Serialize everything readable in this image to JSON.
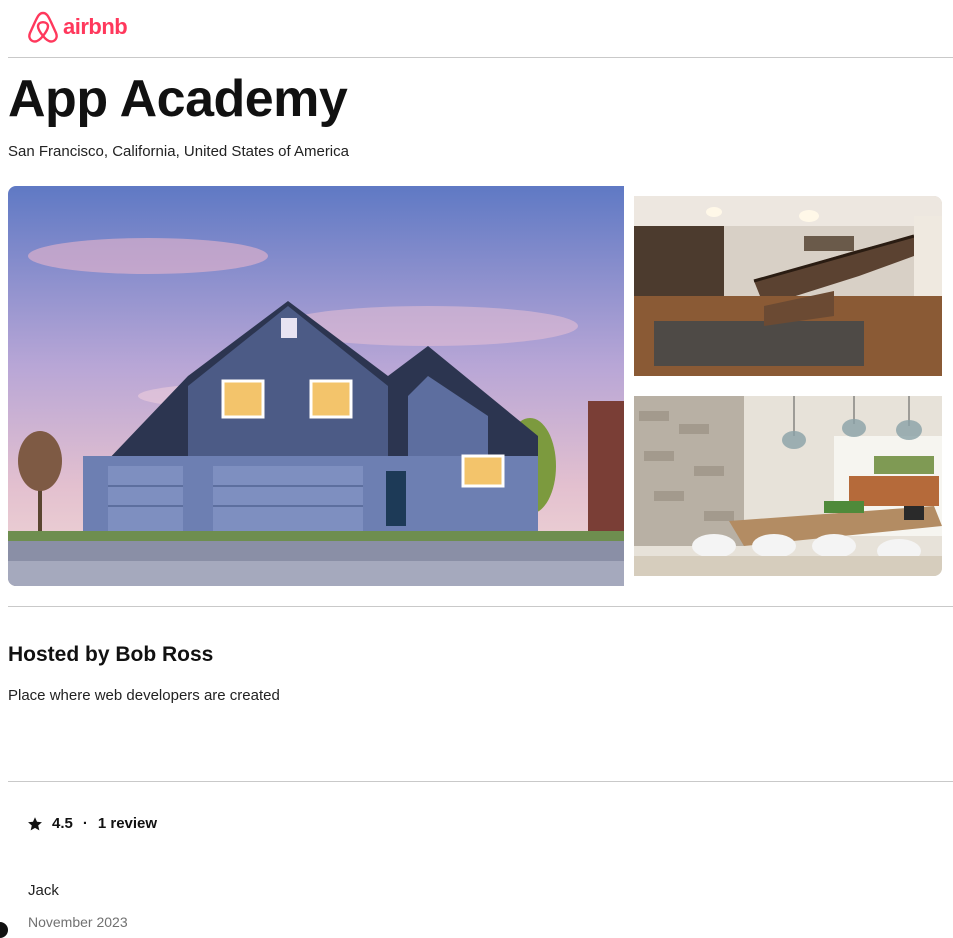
{
  "header": {
    "brand": "airbnb",
    "brand_color": "#ff385c",
    "logo_icon": "airbnb-belo-icon"
  },
  "listing": {
    "title": "App Academy",
    "location": "San Francisco, California, United States of America",
    "photos": {
      "main": "house-exterior-image",
      "top": "staircase-interior-image",
      "bottom": "dining-room-image"
    },
    "hosted_by": "Hosted by Bob Ross",
    "description": "Place where web developers are created"
  },
  "reviews": {
    "icon": "star-icon",
    "rating": "4.5",
    "separator": "·",
    "count_label": "1 review",
    "items": [
      {
        "author": "Jack",
        "date": "November 2023"
      }
    ]
  }
}
